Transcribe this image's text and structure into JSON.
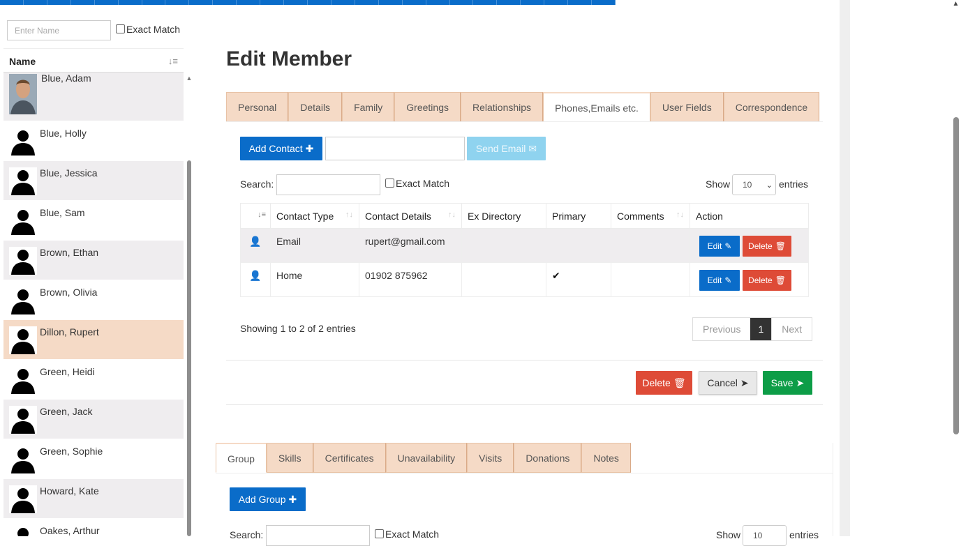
{
  "left_panel": {
    "name_placeholder": "Enter Name",
    "exact_match_label": "Exact Match",
    "column_header": "Name",
    "members": [
      {
        "name": "Blue, Adam"
      },
      {
        "name": "Blue, Holly"
      },
      {
        "name": "Blue, Jessica"
      },
      {
        "name": "Blue, Sam"
      },
      {
        "name": "Brown, Ethan"
      },
      {
        "name": "Brown, Olivia"
      },
      {
        "name": "Dillon, Rupert",
        "selected": true
      },
      {
        "name": "Green, Heidi"
      },
      {
        "name": "Green, Jack"
      },
      {
        "name": "Green, Sophie"
      },
      {
        "name": "Howard, Kate"
      },
      {
        "name": "Oakes, Arthur"
      }
    ]
  },
  "main": {
    "title": "Edit Member",
    "tabs": [
      {
        "label": "Personal"
      },
      {
        "label": "Details"
      },
      {
        "label": "Family"
      },
      {
        "label": "Greetings"
      },
      {
        "label": "Relationships"
      },
      {
        "label": "Phones,Emails etc.",
        "active": true
      },
      {
        "label": "User Fields"
      },
      {
        "label": "Correspondence"
      }
    ],
    "add_contact_label": "Add Contact",
    "send_email_label": "Send Email",
    "search_label": "Search:",
    "exact_match_label": "Exact Match",
    "show_label": "Show",
    "show_value": "10",
    "entries_label": "entries",
    "table": {
      "headers": [
        "Contact Type",
        "Contact Details",
        "Ex Directory",
        "Primary",
        "Comments",
        "Action"
      ],
      "rows": [
        {
          "type": "Email",
          "details": "rupert@gmail.com",
          "ex_directory": "",
          "primary": false,
          "comments": ""
        },
        {
          "type": "Home",
          "details": "01902 875962",
          "ex_directory": "",
          "primary": true,
          "comments": ""
        }
      ],
      "edit_label": "Edit",
      "delete_label": "Delete"
    },
    "showing_text": "Showing 1 to 2 of 2 entries",
    "pagination": {
      "previous": "Previous",
      "current": "1",
      "next": "Next"
    },
    "delete_label": "Delete",
    "cancel_label": "Cancel",
    "save_label": "Save"
  },
  "lower": {
    "tabs": [
      {
        "label": "Group",
        "active": true
      },
      {
        "label": "Skills"
      },
      {
        "label": "Certificates"
      },
      {
        "label": "Unavailability"
      },
      {
        "label": "Visits"
      },
      {
        "label": "Donations"
      },
      {
        "label": "Notes"
      }
    ],
    "add_group_label": "Add Group",
    "search_label": "Search:",
    "exact_match_label": "Exact Match",
    "show_label": "Show",
    "show_value": "10",
    "entries_label": "entries"
  },
  "colors": {
    "primary_blue": "#0a6cc9",
    "danger_red": "#de4b37",
    "success_green": "#0d9d47",
    "tab_peach": "#f5dac6"
  }
}
